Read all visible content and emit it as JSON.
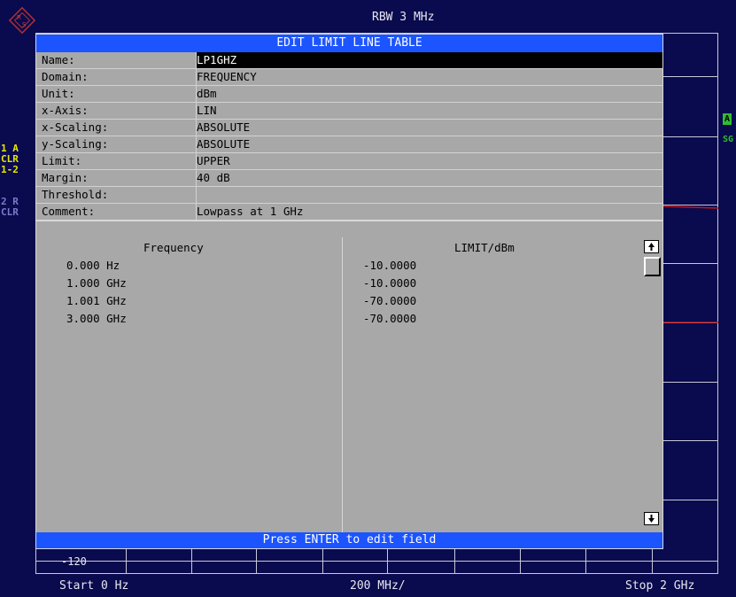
{
  "header": {
    "rbw": "RBW 3 MHz"
  },
  "side_labels": [
    "1 A",
    "CLR",
    "1-2",
    "2 R",
    "CLR"
  ],
  "right_labels": {
    "badge": "A",
    "sgl": "SG"
  },
  "dialog": {
    "title": "EDIT LIMIT LINE TABLE",
    "fields": [
      {
        "label": "Name:",
        "value": "LP1GHZ",
        "selected": true
      },
      {
        "label": "Domain:",
        "value": "FREQUENCY"
      },
      {
        "label": "Unit:",
        "value": "dBm"
      },
      {
        "label": "x-Axis:",
        "value": "LIN"
      },
      {
        "label": "x-Scaling:",
        "value": "ABSOLUTE"
      },
      {
        "label": "y-Scaling:",
        "value": "ABSOLUTE"
      },
      {
        "label": "Limit:",
        "value": "UPPER"
      },
      {
        "label": "Margin:",
        "value": "40 dB"
      },
      {
        "label": "Threshold:",
        "value": ""
      },
      {
        "label": "Comment:",
        "value": "Lowpass at 1 GHz"
      }
    ],
    "table": {
      "col1": "Frequency",
      "col2": "LIMIT/dBm",
      "rows": [
        {
          "freq": "0.000 Hz",
          "limit": "-10.0000"
        },
        {
          "freq": "1.000 GHz",
          "limit": "-10.0000"
        },
        {
          "freq": "1.001 GHz",
          "limit": "-70.0000"
        },
        {
          "freq": "3.000 GHz",
          "limit": "-70.0000"
        }
      ]
    },
    "footer": "Press ENTER to edit field"
  },
  "graph": {
    "ref_label": "-120"
  },
  "bottom": {
    "start": "Start 0 Hz",
    "center": "200 MHz/",
    "stop": "Stop 2 GHz"
  },
  "colors": {
    "background": "#0a0a4e",
    "title_blue": "#1c54ff",
    "panel_gray": "#a8a8a8",
    "trace_red": "#c01818"
  }
}
